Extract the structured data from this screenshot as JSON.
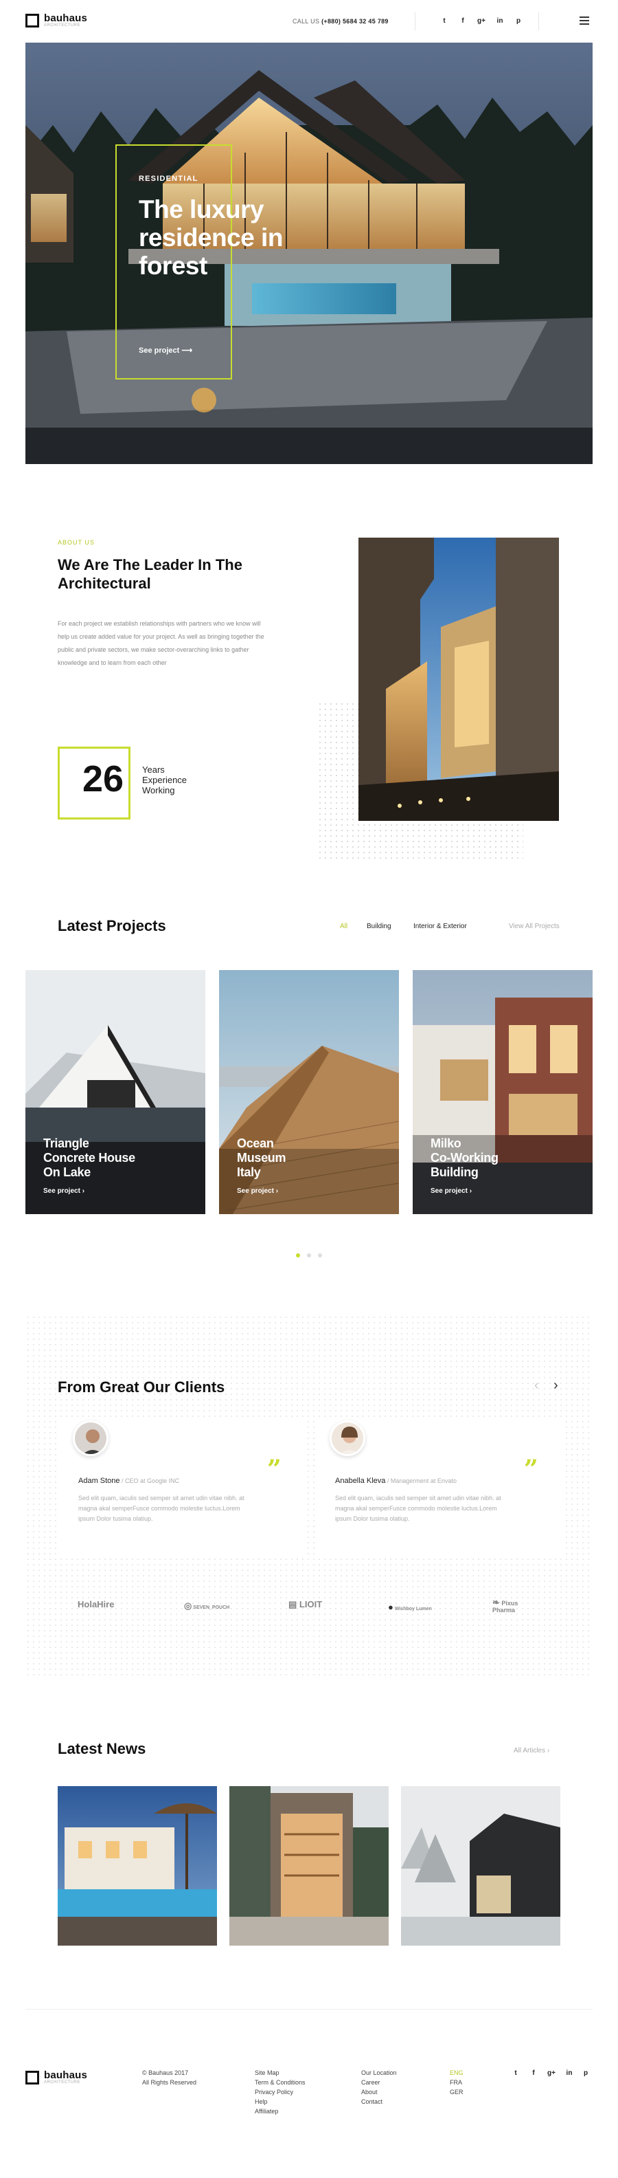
{
  "header": {
    "logo_name": "bauhaus",
    "logo_sub": "ARCHITECTURE",
    "call_label": "CALL US",
    "call_number": "(+880) 5684 32 45 789",
    "social_icons": [
      "twitter-icon",
      "facebook-icon",
      "google-plus-icon",
      "linkedin-icon",
      "pinterest-icon"
    ],
    "social_glyphs": [
      "t",
      "f",
      "g+",
      "in",
      "p"
    ]
  },
  "hero": {
    "tag": "RESIDENTIAL",
    "title_line1": "The luxury",
    "title_line2": "residence in",
    "title_line3": "forest",
    "link": "See project"
  },
  "about": {
    "eyebrow": "ABOUT US",
    "title_line1": "We Are The Leader In The",
    "title_line2": "Architectural",
    "body_line1": "For each project we establish relationships with partners who we know will",
    "body_line2": "help us create added value for your project. As well as bringing together the",
    "body_line3": "public and private sectors, we make sector-overarching links to gather",
    "body_line4": "knowledge and to learn from each other",
    "years_number": "26",
    "years_line1": "Years",
    "years_line2": "Experience",
    "years_line3": "Working"
  },
  "projects": {
    "title": "Latest Projects",
    "filters": [
      "All",
      "Building",
      "Interior & Exterior"
    ],
    "view_all": "View All Projects",
    "items": [
      {
        "line1": "Triangle",
        "line2": "Concrete House",
        "line3": "On Lake",
        "link": "See project"
      },
      {
        "line1": "Ocean",
        "line2": "Museum",
        "line3": "Italy",
        "link": "See project"
      },
      {
        "line1": "Milko",
        "line2": "Co-Working",
        "line3": "Building",
        "link": "See project"
      }
    ]
  },
  "clients": {
    "title": "From Great Our Clients",
    "testimonials": [
      {
        "name": "Adam Stone",
        "role": " / CEO at Google INC",
        "text_line1": "Sed elit quam, iaculis sed semper sit amet udin vitae nibh. at",
        "text_line2": "magna akal semperFusce commodo molestie luctus.Lorem",
        "text_line3": "ipsum Dolor tusima olatiup."
      },
      {
        "name": "Anabella Kleva",
        "role": " / Managerment at Envato",
        "text_line1": "Sed elit quam, iaculis sed semper sit amet udin vitae nibh. at",
        "text_line2": "magna akal semperFusce commodo molestie luctus.Lorem",
        "text_line3": "ipsum Dolor tusima olatiup."
      }
    ],
    "logos": [
      "HolaHire",
      "SEVEN_POUCH",
      "LIOIT",
      "Wishboy Lumen",
      "Pixus Pharma"
    ]
  },
  "news": {
    "title": "Latest News",
    "all_articles": "All Articles"
  },
  "footer": {
    "logo_name": "bauhaus",
    "logo_sub": "ARCHITECTURE",
    "copyright_line1": "© Bauhaus 2017",
    "copyright_line2": "All Rights Reserved",
    "links_col1": [
      "Site Map",
      "Term & Conditions",
      "Privacy Policy",
      "Help",
      "Affiliatep"
    ],
    "links_col2": [
      "Our Location",
      "Career",
      "About",
      "Contact"
    ],
    "langs": [
      "ENG",
      "FRA",
      "GER"
    ]
  },
  "colors": {
    "accent": "#c8dc2e",
    "text": "#111111"
  }
}
